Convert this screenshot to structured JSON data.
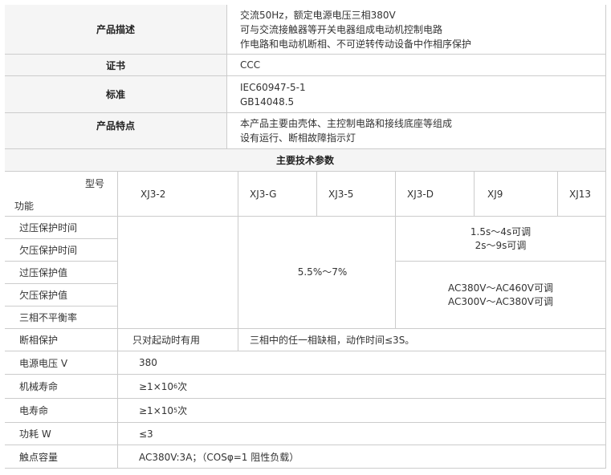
{
  "desc": {
    "label": "产品描述",
    "lines": [
      "交流50Hz，额定电源电压三相380V",
      "可与交流接触器等开关电器组成电动机控制电路",
      "作电路和电动机断相、不可逆转传动设备中作相序保护"
    ]
  },
  "cert": {
    "label": "证书",
    "value": "CCC"
  },
  "std": {
    "label": "标准",
    "lines": [
      "IEC60947-5-1",
      "GB14048.5"
    ]
  },
  "feat": {
    "label": "产品特点",
    "lines": [
      "本产品主要由壳体、主控制电路和接线底座等组成",
      "设有运行、断相故障指示灯"
    ]
  },
  "params_title": "主要技术参数",
  "head": {
    "model": "型号",
    "function": "功能"
  },
  "models": [
    "XJ3-2",
    "XJ3-G",
    "XJ3-5",
    "XJ3-D",
    "XJ9",
    "XJ13"
  ],
  "rows": {
    "r1": "过压保护时间",
    "r2": "欠压保护时间",
    "r3": "过压保护值",
    "r4": "欠压保护值",
    "r5": "三相不平衡率",
    "r6": "断相保护",
    "r7": "电源电压 V",
    "r8": "机械寿命",
    "r9": "电寿命",
    "r10": "功耗   W",
    "r11": "触点容量"
  },
  "vals": {
    "time_lines": [
      "1.5s～4s可调",
      "2s～9s可调"
    ],
    "imbalance": "5.5%～7%",
    "volt_lines": [
      "AC380V～AC460V可调",
      "AC300V～AC380V可调"
    ],
    "phase_a": "只对起动时有用",
    "phase_b": "三相中的任一相缺相，动作时间≤3S。",
    "supply": "380",
    "mech_base": "≥1×10",
    "mech_exp": "6",
    "mech_unit": "次",
    "elec_base": "≥1×10",
    "elec_exp": "5",
    "elec_unit": "次",
    "power": "≤3",
    "contact": "AC380V:3A；（COSφ=1 阻性负载）"
  }
}
